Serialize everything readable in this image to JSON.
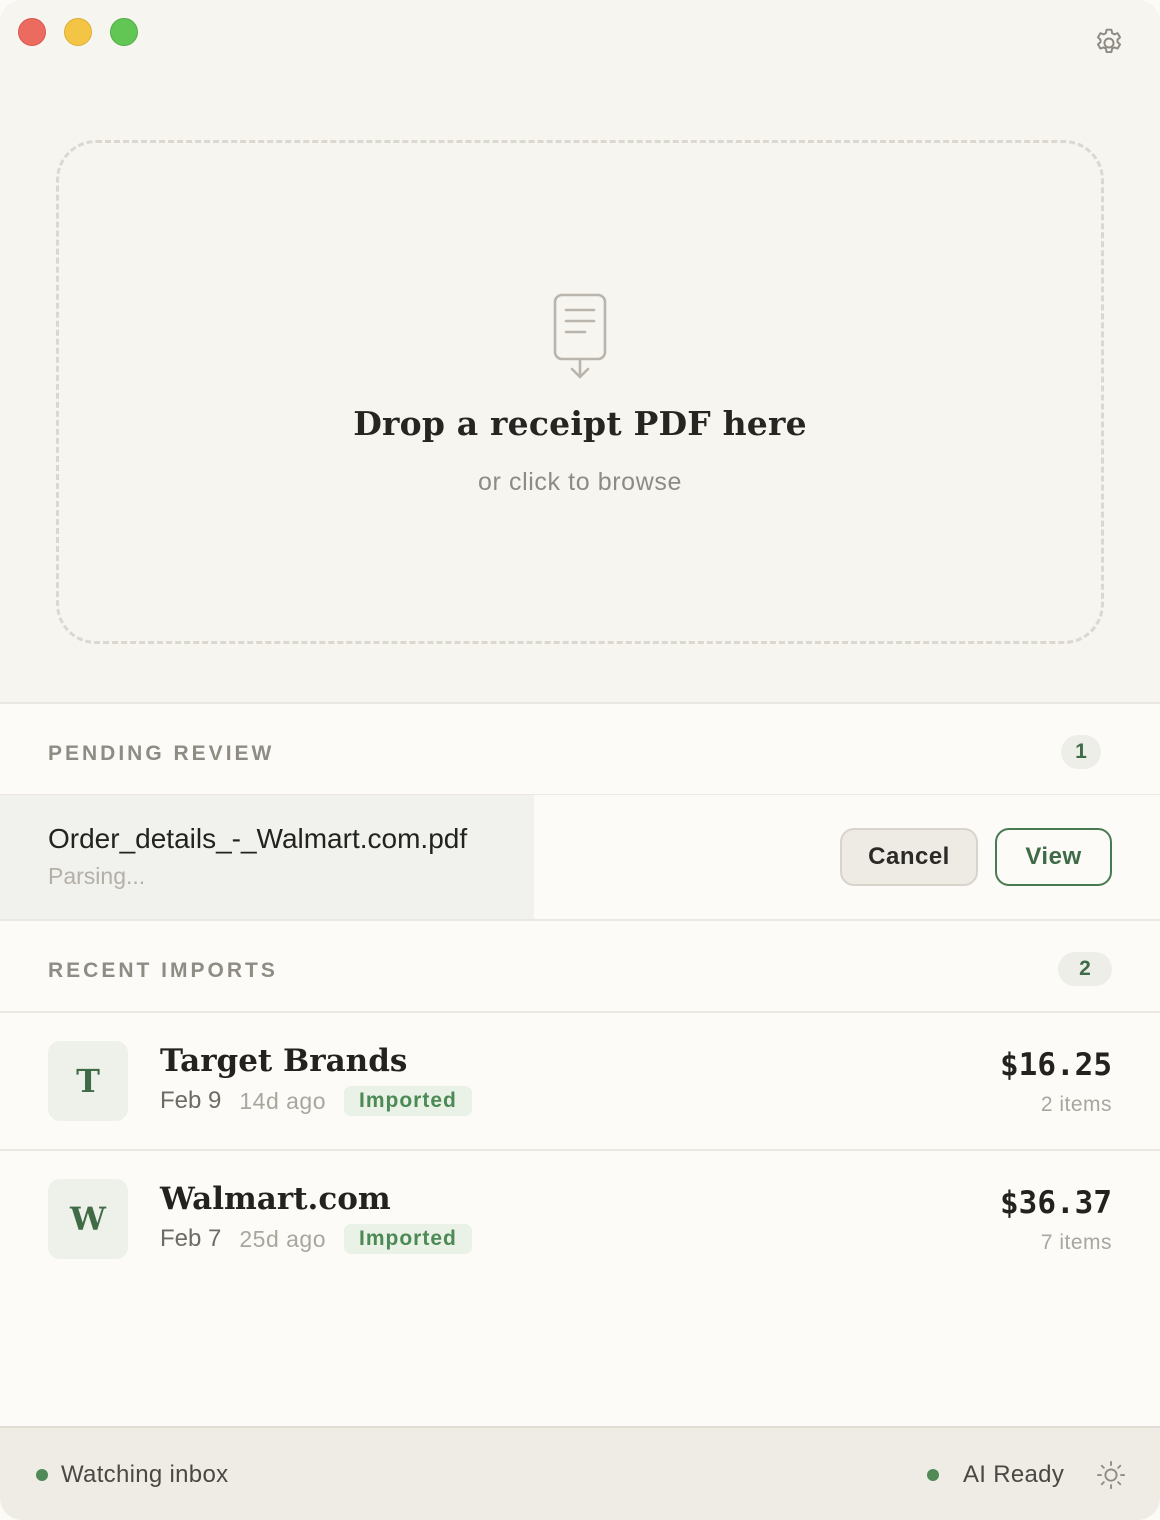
{
  "window": {
    "traffic_lights": [
      "close",
      "minimize",
      "zoom"
    ],
    "colors": {
      "close": "#ec6a5f",
      "minimize": "#f4c444",
      "zoom": "#62c655"
    }
  },
  "toolbar": {
    "settings_icon": "gear-icon"
  },
  "dropzone": {
    "icon": "document-download-icon",
    "title": "Drop a receipt PDF here",
    "subtitle": "or click to browse"
  },
  "pending": {
    "heading": "PENDING REVIEW",
    "count": "1",
    "items": [
      {
        "file_name": "Order_details_-_Walmart.com.pdf",
        "status": "Parsing...",
        "progress": 0.46,
        "cancel_label": "Cancel",
        "view_label": "View"
      }
    ]
  },
  "recent": {
    "heading": "RECENT IMPORTS",
    "count": "2",
    "items": [
      {
        "initial": "T",
        "merchant": "Target Brands",
        "date": "Feb 9",
        "ago": "14d ago",
        "status": "Imported",
        "amount": "$16.25",
        "items": "2 items"
      },
      {
        "initial": "W",
        "merchant": "Walmart.com",
        "date": "Feb 7",
        "ago": "25d ago",
        "status": "Imported",
        "amount": "$36.37",
        "items": "7 items"
      }
    ]
  },
  "statusbar": {
    "left_text": "Watching inbox",
    "right_text": "AI Ready",
    "theme_icon": "sun-icon",
    "indicator_color": "#4f8a57"
  },
  "colors": {
    "accent": "#3f6b46",
    "background": "#fcfbf8",
    "imported_badge_bg": "#eaf1e6"
  }
}
